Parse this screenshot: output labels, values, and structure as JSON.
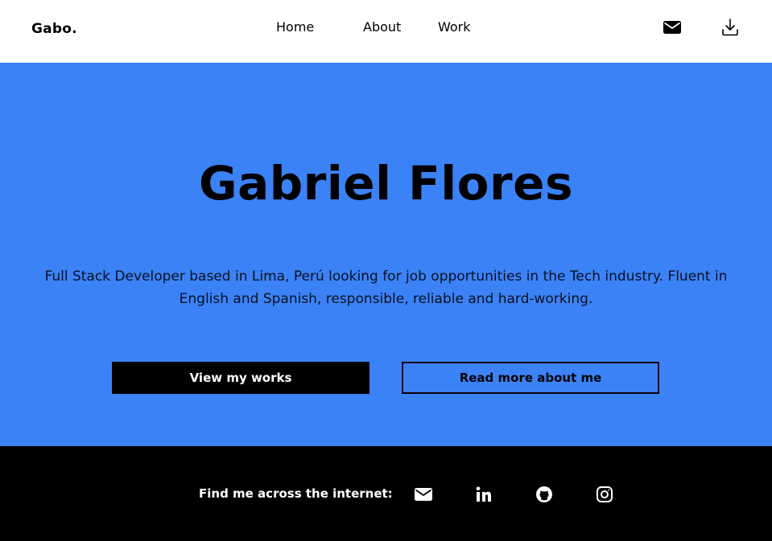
{
  "navbar": {
    "logo": "Gabo.",
    "links": [
      {
        "label": "Home"
      },
      {
        "label": "About"
      },
      {
        "label": "Work"
      }
    ],
    "icons": [
      "mail-icon",
      "download-icon"
    ]
  },
  "hero": {
    "title": "Gabriel Flores",
    "description": "Full Stack Developer based in Lima, Perú looking for job opportunities in the Tech industry. Fluent in English and Spanish, responsible, reliable and hard-working.",
    "buttons": {
      "primary": "View my works",
      "secondary": "Read more about me"
    },
    "background_color": "#3b82f6"
  },
  "footer": {
    "label": "Find me across the internet:",
    "social_icons": [
      "mail-icon",
      "linkedin-icon",
      "github-icon",
      "instagram-icon"
    ],
    "background_color": "#000000"
  }
}
